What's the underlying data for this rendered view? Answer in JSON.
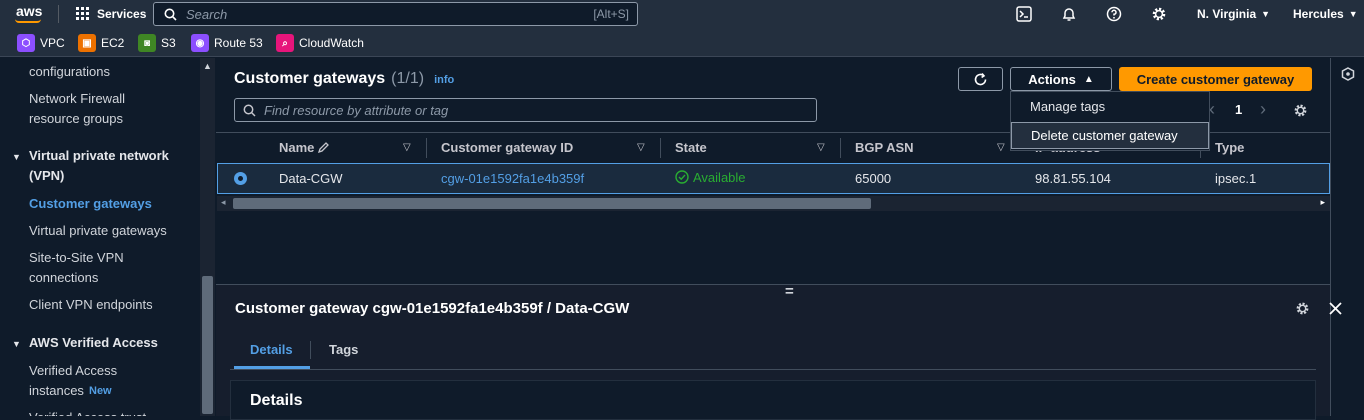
{
  "topbar": {
    "logo": "aws",
    "services_label": "Services",
    "search_placeholder": "Search",
    "search_shortcut": "[Alt+S]",
    "region": "N. Virginia",
    "account": "Hercules"
  },
  "favorites": [
    {
      "label": "VPC",
      "color": "#8c4fff"
    },
    {
      "label": "EC2",
      "color": "#ed7100"
    },
    {
      "label": "S3",
      "color": "#3f8624"
    },
    {
      "label": "Route 53",
      "color": "#8c4fff"
    },
    {
      "label": "CloudWatch",
      "color": "#e7157b"
    }
  ],
  "sidebar": {
    "items_top": [
      "configurations",
      "Network Firewall",
      "resource groups"
    ],
    "section_vpn": "Virtual private network",
    "section_vpn_2": "(VPN)",
    "vpn_items": [
      "Customer gateways",
      "Virtual private gateways",
      "Site-to-Site VPN",
      "connections",
      "Client VPN endpoints"
    ],
    "section_verified": "AWS Verified Access",
    "verified_items": [
      "Verified Access",
      "instances",
      "New",
      "Verified Access trust"
    ]
  },
  "main": {
    "title": "Customer gateways",
    "count": "(1/1)",
    "info": "info",
    "filter_placeholder": "Find resource by attribute or tag",
    "actions_label": "Actions",
    "create_label": "Create customer gateway",
    "menu_items": [
      "Manage tags",
      "Delete customer gateway"
    ],
    "page": "1",
    "columns": [
      "Name",
      "Customer gateway ID",
      "State",
      "BGP ASN",
      "IP address",
      "Type"
    ],
    "row": {
      "name": "Data-CGW",
      "id": "cgw-01e1592fa1e4b359f",
      "state": "Available",
      "bgp": "65000",
      "ip": "98.81.55.104",
      "type": "ipsec.1"
    }
  },
  "detail": {
    "title": "Customer gateway cgw-01e1592fa1e4b359f / Data-CGW",
    "tabs": [
      "Details",
      "Tags"
    ],
    "section": "Details",
    "divider": "="
  },
  "colors": {
    "accent": "#ff9900",
    "link": "#539fe5",
    "success": "#29ad32"
  }
}
